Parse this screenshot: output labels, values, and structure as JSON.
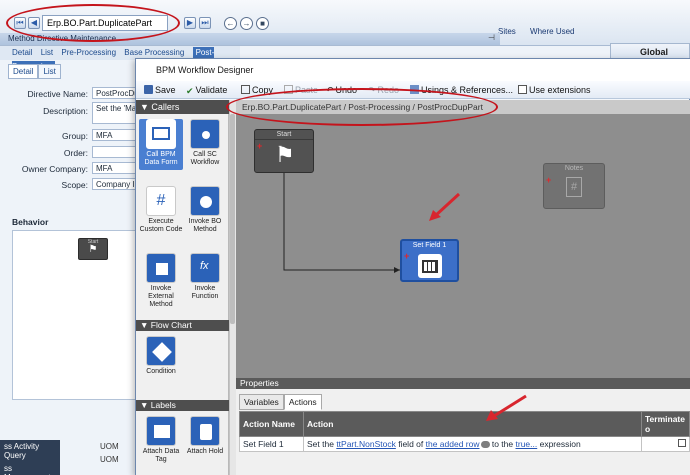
{
  "background_window": {
    "method_code": "Erp.BO.Part.DuplicatePart",
    "title": "Method Directive Maintenance",
    "right_tabs": [
      "Sites",
      "Where Used"
    ],
    "menu_tabs": [
      "Detail",
      "List",
      "Pre-Processing",
      "Base Processing",
      "Post-Processing"
    ],
    "detail_tabs": [
      "Detail",
      "List"
    ],
    "form": {
      "directive_name_label": "Directive Name:",
      "directive_name_value": "PostProcDu",
      "description_label": "Description:",
      "description_value": "Set the 'May",
      "group_label": "Group:",
      "group_value": "MFA",
      "order_label": "Order:",
      "order_value": "",
      "owner_company_label": "Owner Company:",
      "owner_company_value": "MFA",
      "scope_label": "Scope:",
      "scope_value": "Company In"
    },
    "behavior_label": "Behavior",
    "behavior_start": "Start",
    "global_lock": "Global Lock",
    "bottom_list": [
      "ss Activity Query",
      "ss Management"
    ],
    "uom_list": [
      "UOM",
      "UOM"
    ]
  },
  "designer": {
    "title": "BPM Workflow Designer",
    "toolbar": {
      "save": "Save",
      "validate": "Validate",
      "copy": "Copy",
      "paste": "Paste",
      "undo": "Undo",
      "redo": "Redo",
      "usings": "Usings & References...",
      "use_extensions": "Use extensions"
    },
    "path": "Erp.BO.Part.DuplicatePart / Post-Processing / PostProcDupPart",
    "groups": {
      "callers": "Callers",
      "flow_chart": "Flow Chart",
      "labels": "Labels"
    },
    "tools": {
      "call_bpm": "Call BPM Data Form",
      "call_sc": "Call SC Workflow",
      "execute_custom": "Execute Custom Code",
      "invoke_bo": "Invoke BO Method",
      "invoke_external": "Invoke External Method",
      "invoke_function": "Invoke Function",
      "condition": "Condition",
      "attach_data_tag": "Attach Data Tag",
      "attach_hold": "Attach Hold"
    },
    "canvas": {
      "start_label": "Start",
      "notes_label": "Notes",
      "set_field_label": "Set Field 1"
    },
    "properties": {
      "header": "Properties",
      "tabs": [
        "Variables",
        "Actions"
      ],
      "columns": [
        "Action Name",
        "Action",
        "Terminate o"
      ],
      "row": {
        "name": "Set Field 1",
        "text1": "Set the ",
        "field": "ttPart.NonStock",
        "text2": " field of ",
        "row_ref": "the added row",
        "text3": " to the ",
        "expr": "true...",
        "text4": " expression"
      }
    }
  },
  "colors": {
    "accent": "#3c6fc8",
    "annotation": "#c4141c"
  }
}
